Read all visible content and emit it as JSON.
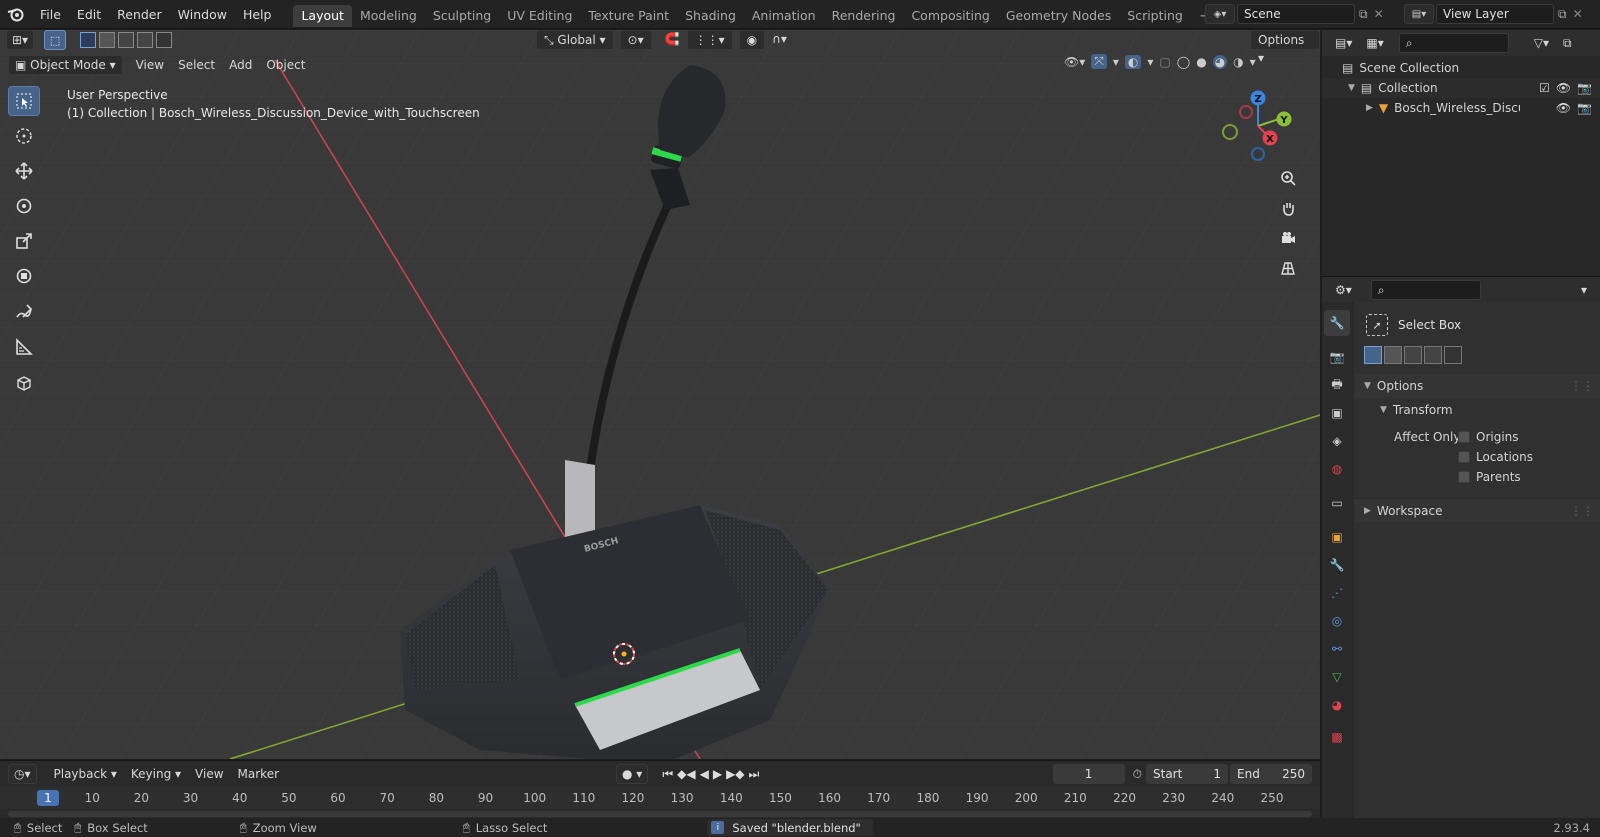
{
  "topbar": {
    "menus": [
      "File",
      "Edit",
      "Render",
      "Window",
      "Help"
    ],
    "workspaces": [
      "Layout",
      "Modeling",
      "Sculpting",
      "UV Editing",
      "Texture Paint",
      "Shading",
      "Animation",
      "Rendering",
      "Compositing",
      "Geometry Nodes",
      "Scripting"
    ],
    "active_workspace": "Layout",
    "scene_name": "Scene",
    "view_layer": "View Layer"
  },
  "viewport_toolbar": {
    "orientation": "Global",
    "options_label": "Options",
    "mode": "Object Mode",
    "menus": [
      "View",
      "Select",
      "Add",
      "Object"
    ]
  },
  "viewport": {
    "perspective_label": "User Perspective",
    "collection_label": "(1) Collection | Bosch_Wireless_Discussion_Device_with_Touchscreen",
    "brand_text": "BOSCH",
    "gizmo": {
      "z": "Z",
      "y": "Y",
      "x": "X"
    }
  },
  "outliner": {
    "scene_collection": "Scene Collection",
    "collection": "Collection",
    "object": "Bosch_Wireless_Discussi"
  },
  "properties": {
    "tool_name": "Select Box",
    "options_label": "Options",
    "transform_label": "Transform",
    "affect_only_label": "Affect Only",
    "affect_options": [
      "Origins",
      "Locations",
      "Parents"
    ],
    "workspace_label": "Workspace"
  },
  "timeline": {
    "menus": [
      "Playback",
      "Keying",
      "View",
      "Marker"
    ],
    "current_frame": "1",
    "start_label": "Start",
    "start_value": "1",
    "end_label": "End",
    "end_value": "250",
    "ticks": [
      "1",
      "10",
      "20",
      "30",
      "40",
      "50",
      "60",
      "70",
      "80",
      "90",
      "100",
      "110",
      "120",
      "130",
      "140",
      "150",
      "160",
      "170",
      "180",
      "190",
      "200",
      "210",
      "220",
      "230",
      "240",
      "250"
    ]
  },
  "statusbar": {
    "select": "Select",
    "box_select": "Box Select",
    "zoom_view": "Zoom View",
    "lasso_select": "Lasso Select",
    "message": "Saved \"blender.blend\"",
    "version": "2.93.4"
  },
  "colors": {
    "accent": "#4772b3",
    "x_axis": "#e04250",
    "y_axis": "#8cbf36",
    "z_axis": "#3a86e0",
    "led_green": "#2bd94a"
  }
}
